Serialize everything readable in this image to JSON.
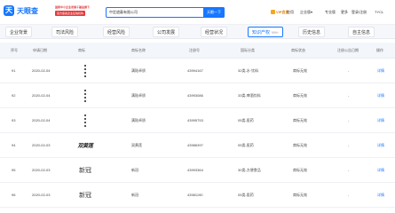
{
  "header": {
    "logo_mark": "天",
    "logo_text": "天眼查",
    "promo_line1": "国家中小企业发展子基金旗下",
    "promo_line2": "官方备案企业征信机构",
    "search_value": "中定遮蔽有限公司",
    "search_button": "天眼一下",
    "nav": {
      "vip": "VIP会员",
      "app": "应用",
      "enterprise": "企业版",
      "enterprise_arrow": "▾",
      "pro": "专业版",
      "more": "更多",
      "login": "登录/注册",
      "user": "TYCL"
    }
  },
  "tabs": [
    {
      "label": "企业背景",
      "count": "",
      "active": false
    },
    {
      "label": "司法风险",
      "count": "",
      "active": false
    },
    {
      "label": "经营风险",
      "count": "",
      "active": false
    },
    {
      "label": "公司发展",
      "count": "",
      "active": false
    },
    {
      "label": "经营状况",
      "count": "",
      "active": false
    },
    {
      "label": "知识产权",
      "count": "999+",
      "active": true
    },
    {
      "label": "历史信息",
      "count": "",
      "active": false
    },
    {
      "label": "自主信息",
      "count": "",
      "active": false
    }
  ],
  "table": {
    "columns": [
      "序号",
      "申请日期",
      "商标",
      "商标名称",
      "注册号",
      "国际分类",
      "商标状态",
      "注册公告日期",
      "操作"
    ],
    "rows": [
      {
        "index": "91",
        "date": "2020-02-04",
        "logo": "vertical-text",
        "name": "满陆卓质",
        "reg_no": "43994167",
        "category": "32类-水·饮料",
        "status": "商标无效",
        "pub_date": "-",
        "action": "详情"
      },
      {
        "index": "92",
        "date": "2020-02-04",
        "logo": "vertical-text",
        "name": "满陆卓质",
        "reg_no": "43993086",
        "category": "33类-啤酒饮料",
        "status": "商标无效",
        "pub_date": "-",
        "action": "详情"
      },
      {
        "index": "93",
        "date": "2020-02-04",
        "logo": "vertical-text",
        "name": "满陆卓质",
        "reg_no": "43995753",
        "category": "05类-医药",
        "status": "商标无效",
        "pub_date": "-",
        "action": "详情"
      },
      {
        "index": "94",
        "date": "2020-02-03",
        "logo": "calligraphy",
        "logo_text": "双黄莲",
        "name": "双黄莲",
        "reg_no": "43986397",
        "category": "05类-医药",
        "status": "商标无效",
        "pub_date": "-",
        "action": "详情"
      },
      {
        "index": "95",
        "date": "2020-02-03",
        "logo": "text",
        "logo_text": "新冠",
        "name": "新冠",
        "reg_no": "43993364",
        "category": "30类-方便食品",
        "status": "商标无效",
        "pub_date": "-",
        "action": "详情"
      },
      {
        "index": "96",
        "date": "2020-02-03",
        "logo": "text",
        "logo_text": "新冠",
        "name": "新冠",
        "reg_no": "43981190",
        "category": "05类-医药",
        "status": "商标无效",
        "pub_date": "-",
        "action": "详情"
      }
    ]
  }
}
